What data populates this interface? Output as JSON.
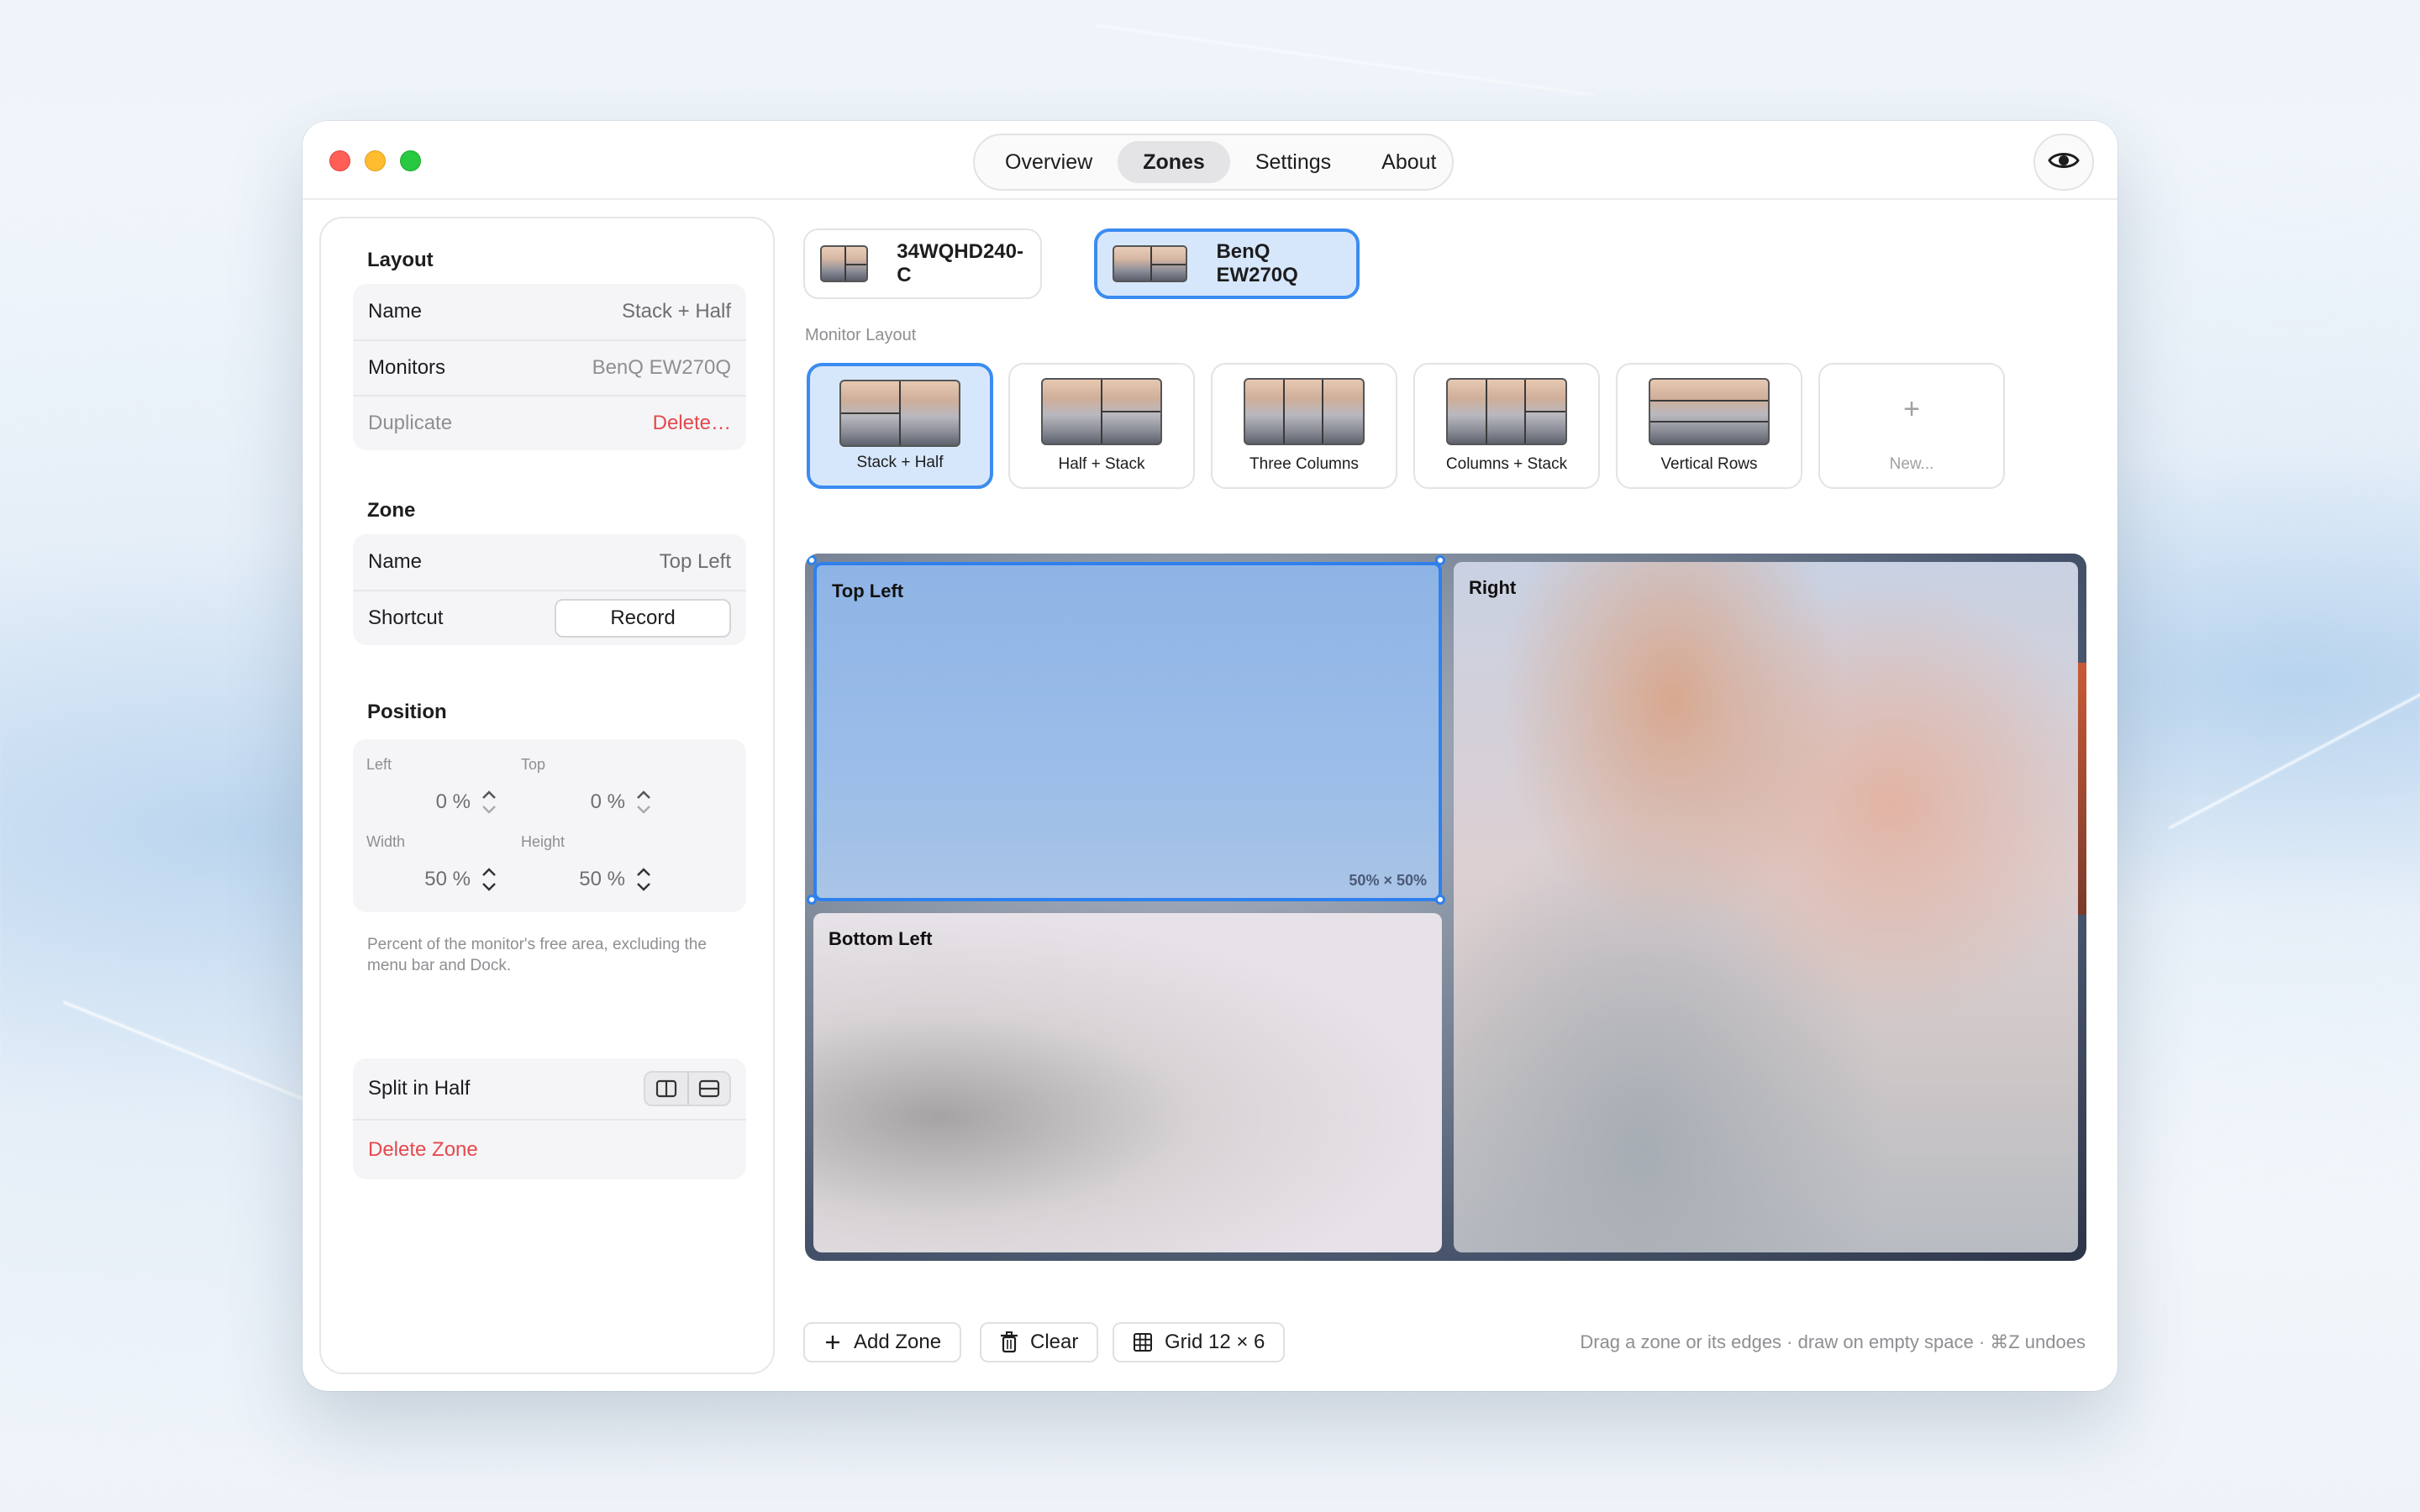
{
  "tabs": [
    {
      "label": "Overview",
      "active": false
    },
    {
      "label": "Zones",
      "active": true
    },
    {
      "label": "Settings",
      "active": false
    },
    {
      "label": "About",
      "active": false
    }
  ],
  "sidebar": {
    "layout": {
      "title": "Layout",
      "name_label": "Name",
      "name_value": "Stack + Half",
      "monitors_label": "Monitors",
      "monitors_value": "BenQ EW270Q",
      "duplicate_label": "Duplicate",
      "delete_label": "Delete…"
    },
    "zone": {
      "title": "Zone",
      "name_label": "Name",
      "name_value": "Top Left",
      "shortcut_label": "Shortcut",
      "record_label": "Record"
    },
    "position": {
      "title": "Position",
      "left_label": "Left",
      "left_value": "0",
      "top_label": "Top",
      "top_value": "0",
      "width_label": "Width",
      "width_value": "50",
      "height_label": "Height",
      "height_value": "50",
      "unit": "%",
      "hint": "Percent of the monitor's free area, excluding the menu bar and Dock."
    },
    "actions": {
      "split_label": "Split in Half",
      "delete_zone_label": "Delete Zone"
    }
  },
  "monitors": [
    {
      "name": "34WQHD240-C",
      "active": false
    },
    {
      "name": "BenQ EW270Q",
      "active": true
    }
  ],
  "monitor_layout_label": "Monitor Layout",
  "layouts": [
    {
      "name": "Stack + Half",
      "active": true
    },
    {
      "name": "Half + Stack",
      "active": false
    },
    {
      "name": "Three Columns",
      "active": false
    },
    {
      "name": "Columns + Stack",
      "active": false
    },
    {
      "name": "Vertical Rows",
      "active": false
    },
    {
      "name": "New...",
      "plus": "+",
      "active": false
    }
  ],
  "zones": {
    "top_left": {
      "name": "Top Left",
      "dims": "50% × 50%"
    },
    "bottom_left": {
      "name": "Bottom Left"
    },
    "right": {
      "name": "Right"
    }
  },
  "toolbar": {
    "add_zone": "Add Zone",
    "clear": "Clear",
    "grid": "Grid 12 × 6",
    "tip": "Drag a zone or its edges · draw on empty space · ⌘Z undoes"
  },
  "colors": {
    "accent": "#2f80ed",
    "destructive": "#e5484d",
    "selected_bg": "#d7e7fb"
  }
}
